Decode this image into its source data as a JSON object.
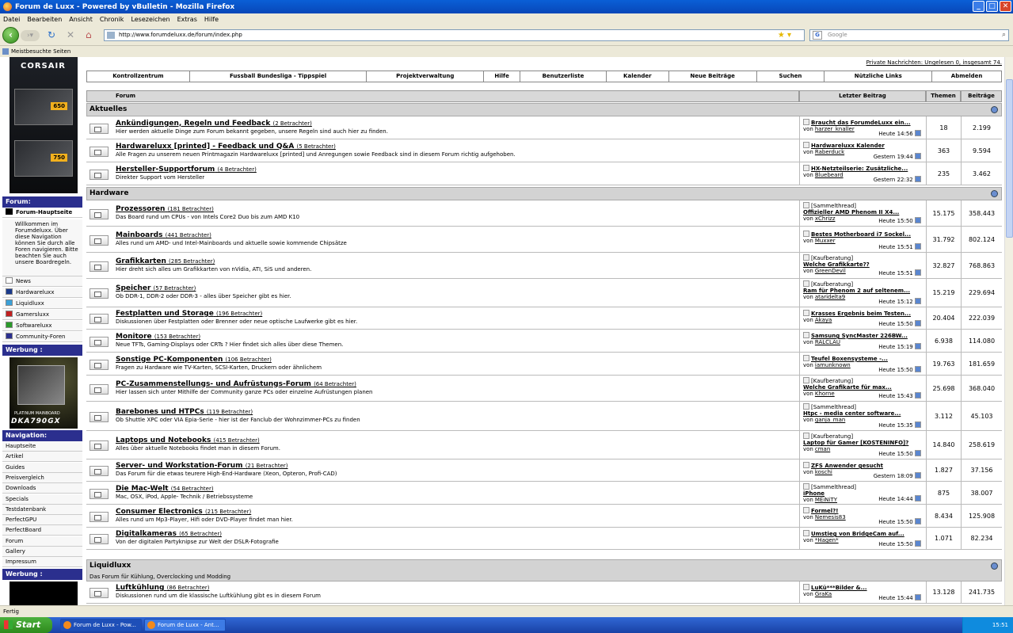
{
  "window": {
    "title": "Forum de Luxx - Powered by vBulletin - Mozilla Firefox"
  },
  "menu": [
    "Datei",
    "Bearbeiten",
    "Ansicht",
    "Chronik",
    "Lesezeichen",
    "Extras",
    "Hilfe"
  ],
  "url": "http://www.forumdeluxx.de/forum/index.php",
  "search_placeholder": "Google",
  "bookmarks_label": "Meistbesuchte Seiten",
  "header": {
    "private_messages": "Private Nachrichten: Ungelesen 0, insgesamt 74."
  },
  "topnav": [
    "Kontrollzentrum",
    "Fussball Bundesliga - Tippspiel",
    "Projektverwaltung",
    "Hilfe",
    "Benutzerliste",
    "Kalender",
    "Neue Beiträge",
    "Suchen",
    "Nützliche Links",
    "Abmelden"
  ],
  "sidebar": {
    "ad_brand": "CORSAIR",
    "ad_psu1": "650",
    "ad_psu2": "750",
    "forum_header": "Forum:",
    "forum_main": "Forum-Hauptseite",
    "welcome": "Willkommen im Forumdeluxx. Über diese Navigation können Sie durch alle Foren navigieren. Bitte beachten Sie auch unsere Boardregeln.",
    "forum_links": [
      {
        "label": "News",
        "color": "#ffffff"
      },
      {
        "label": "Hardwareluxx",
        "color": "#1a3a8c"
      },
      {
        "label": "Liquidluxx",
        "color": "#3aa0d8"
      },
      {
        "label": "Gamersluxx",
        "color": "#c02020"
      },
      {
        "label": "Softwareluxx",
        "color": "#2a9a2a"
      },
      {
        "label": "Community-Foren",
        "color": "#2b2f8e"
      }
    ],
    "ad_header": "Werbung :",
    "ad2_text": "DKA790GX",
    "ad2_sub": "PLATINUM MAINBOARD",
    "nav_header": "Navigation:",
    "nav_links": [
      "Hauptseite",
      "Artikel",
      "Guides",
      "Preisvergleich",
      "Downloads",
      "Specials",
      "Testdatenbank",
      "PerfectGPU",
      "PerfectBoard",
      "Forum",
      "Gallery",
      "Impressum"
    ],
    "ad_header2": "Werbung :"
  },
  "table_header": {
    "forum": "Forum",
    "last": "Letzter Beitrag",
    "themen": "Themen",
    "beitraege": "Beiträge"
  },
  "categories": [
    {
      "name": "Aktuelles",
      "desc": "",
      "forums": [
        {
          "name": "Ankündigungen, Regeln und Feedback",
          "viewers": "(2 Betrachter)",
          "desc": "Hier werden aktuelle Dinge zum Forum bekannt gegeben, unsere Regeln sind auch hier zu finden.",
          "prefix": "",
          "last": "Braucht das ForumdeLuxx ein...",
          "by": "harzer_knaller",
          "time": "Heute 14:56",
          "themen": "18",
          "beitraege": "2.199"
        },
        {
          "name": "Hardwareluxx [printed] - Feedback und Q&A",
          "viewers": "(5 Betrachter)",
          "desc": "Alle Fragen zu unserem neuen Printmagazin Hardwareluxx [printed] und Anregungen sowie Feedback sind in diesem Forum richtig aufgehoben.",
          "prefix": "",
          "last": "Hardwareluxx Kalender",
          "by": "Raberduck",
          "time": "Gestern 19:44",
          "themen": "363",
          "beitraege": "9.594"
        },
        {
          "name": "Hersteller-Supportforum",
          "viewers": "(4 Betrachter)",
          "desc": "Direkter Support vom Hersteller",
          "prefix": "",
          "last": "HX-Netzteilserie: Zusätzliche...",
          "by": "Bluebeard",
          "time": "Gestern 22:32",
          "themen": "235",
          "beitraege": "3.462"
        }
      ]
    },
    {
      "name": "Hardware",
      "desc": "",
      "forums": [
        {
          "name": "Prozessoren",
          "viewers": "(181 Betrachter)",
          "desc": "Das Board rund um CPUs - von Intels Core2 Duo bis zum AMD K10",
          "prefix": "[Sammelthread]",
          "last": "Offizieller AMD Phenom II X4...",
          "by": "xChrizz",
          "time": "Heute 15:50",
          "themen": "15.175",
          "beitraege": "358.443"
        },
        {
          "name": "Mainboards",
          "viewers": "(441 Betrachter)",
          "desc": "Alles rund um AMD- und Intel-Mainboards und aktuelle sowie kommende Chipsätze",
          "prefix": "",
          "last": "Bestes Motherboard i7 Sockel...",
          "by": "Muxxer",
          "time": "Heute 15:51",
          "themen": "31.792",
          "beitraege": "802.124"
        },
        {
          "name": "Grafikkarten",
          "viewers": "(285 Betrachter)",
          "desc": "Hier dreht sich alles um Grafikkarten von nVidia, ATI, SiS und anderen.",
          "prefix": "[Kaufberatung]",
          "last": "Welche Grafikkarte??",
          "by": "GreenDevil",
          "time": "Heute 15:51",
          "themen": "32.827",
          "beitraege": "768.863"
        },
        {
          "name": "Speicher",
          "viewers": "(57 Betrachter)",
          "desc": "Ob DDR-1, DDR-2 oder DDR-3 - alles über Speicher gibt es hier.",
          "prefix": "[Kaufberatung]",
          "last": "Ram für Phenom 2 auf seltenem...",
          "by": "ataridelta9",
          "time": "Heute 15:12",
          "themen": "15.219",
          "beitraege": "229.694"
        },
        {
          "name": "Festplatten und Storage",
          "viewers": "(196 Betrachter)",
          "desc": "Diskussionen über Festplatten oder Brenner oder neue optische Laufwerke gibt es hier.",
          "prefix": "",
          "last": "Krasses Ergebnis beim Testen...",
          "by": "Akaya",
          "time": "Heute 15:50",
          "themen": "20.404",
          "beitraege": "222.039"
        },
        {
          "name": "Monitore",
          "viewers": "(153 Betrachter)",
          "desc": "Neue TFTs, Gaming-Displays oder CRTs ? Hier findet sich alles über diese Themen.",
          "prefix": "",
          "last": "Samsung SyncMaster 226BW...",
          "by": "RALCLAU",
          "time": "Heute 15:19",
          "themen": "6.938",
          "beitraege": "114.080"
        },
        {
          "name": "Sonstige PC-Komponenten",
          "viewers": "(106 Betrachter)",
          "desc": "Fragen zu Hardware wie TV-Karten, SCSI-Karten, Druckern oder ähnlichem",
          "prefix": "",
          "last": "Teufel Boxensysteme -...",
          "by": "iamunknown",
          "time": "Heute 15:50",
          "themen": "19.763",
          "beitraege": "181.659"
        },
        {
          "name": "PC-Zusammenstellungs- und Aufrüstungs-Forum",
          "viewers": "(64 Betrachter)",
          "desc": "Hier lassen sich unter Mithilfe der Community ganze PCs oder einzelne Aufrüstungen planen",
          "prefix": "[Kaufberatung]",
          "last": "Welche Grafikarte für max...",
          "by": "Khorne",
          "time": "Heute 15:43",
          "themen": "25.698",
          "beitraege": "368.040"
        },
        {
          "name": "Barebones und HTPCs",
          "viewers": "(119 Betrachter)",
          "desc": "Ob Shuttle XPC oder VIA Epia-Serie - hier ist der Fanclub der Wohnzimmer-PCs zu finden",
          "prefix": "[Sammelthread]",
          "last": "Htpc - media center software...",
          "by": "ganja_man",
          "time": "Heute 15:35",
          "themen": "3.112",
          "beitraege": "45.103"
        },
        {
          "name": "Laptops und Notebooks",
          "viewers": "(415 Betrachter)",
          "desc": "Alles über aktuelle Notebooks findet man in diesem Forum.",
          "prefix": "[Kaufberatung]",
          "last": "Laptop für Gamer [KOSTENINFO]?",
          "by": "cman",
          "time": "Heute 15:50",
          "themen": "14.840",
          "beitraege": "258.619"
        },
        {
          "name": "Server- und Workstation-Forum",
          "viewers": "(21 Betrachter)",
          "desc": "Das Forum für die etwas teurere High-End-Hardware (Xeon, Opteron, Profi-CAD)",
          "prefix": "",
          "last": "ZFS Anwender gesucht",
          "by": "koschi",
          "time": "Gestern 18:09",
          "themen": "1.827",
          "beitraege": "37.156"
        },
        {
          "name": "Die Mac-Welt",
          "viewers": "(54 Betrachter)",
          "desc": "Mac, OSX, iPod, Apple- Technik / Betriebssysteme",
          "prefix": "[Sammelthread]",
          "last": "iPhone",
          "by": "MEiNiTY",
          "time": "Heute 14:44",
          "themen": "875",
          "beitraege": "38.007"
        },
        {
          "name": "Consumer Electronics",
          "viewers": "(215 Betrachter)",
          "desc": "Alles rund um Mp3-Player, Hifi oder DVD-Player findet man hier.",
          "prefix": "",
          "last": "Formel?!",
          "by": "Nemesis83",
          "time": "Heute 15:50",
          "themen": "8.434",
          "beitraege": "125.908"
        },
        {
          "name": "Digitalkameras",
          "viewers": "(65 Betrachter)",
          "desc": "Von der digitalen Partyknipse zur Welt der DSLR-Fotografie",
          "prefix": "",
          "last": "Umstieg von BridgeCam auf...",
          "by": "*Hagen*",
          "time": "Heute 15:50",
          "themen": "1.071",
          "beitraege": "82.234"
        }
      ]
    },
    {
      "name": "Liquidluxx",
      "desc": "Das Forum für Kühlung, Overclocking und Modding",
      "forums": [
        {
          "name": "Luftkühlung",
          "viewers": "(86 Betrachter)",
          "desc": "Diskussionen rund um die klassische Luftkühlung gibt es in diesem Forum",
          "prefix": "",
          "last": "LuKü***Bilder &...",
          "by": "GraKa",
          "time": "Heute 15:44",
          "themen": "13.128",
          "beitraege": "241.735"
        }
      ]
    }
  ],
  "status": "Fertig",
  "taskbar": {
    "start": "Start",
    "tasks": [
      "Forum de Luxx - Pow...",
      "Forum de Luxx - Ant..."
    ],
    "clock": "15:51"
  }
}
